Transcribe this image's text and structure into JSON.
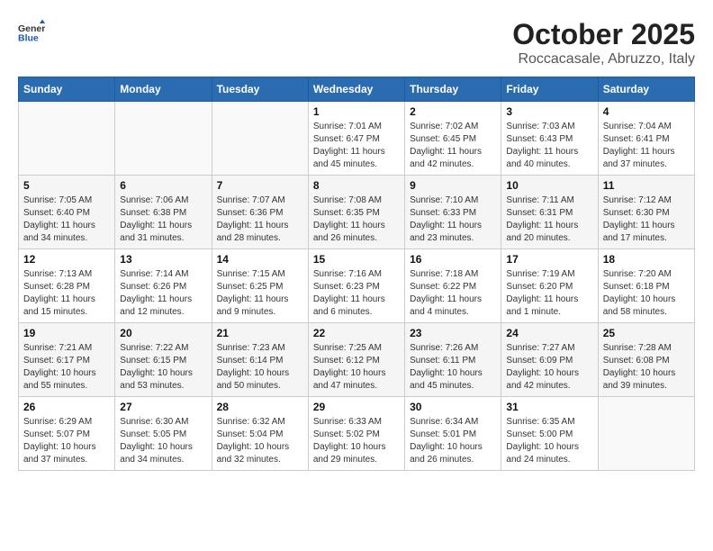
{
  "header": {
    "logo_general": "General",
    "logo_blue": "Blue",
    "month_title": "October 2025",
    "location": "Roccacasale, Abruzzo, Italy"
  },
  "calendar": {
    "weekdays": [
      "Sunday",
      "Monday",
      "Tuesday",
      "Wednesday",
      "Thursday",
      "Friday",
      "Saturday"
    ],
    "weeks": [
      [
        {
          "day": "",
          "sunrise": "",
          "sunset": "",
          "daylight": ""
        },
        {
          "day": "",
          "sunrise": "",
          "sunset": "",
          "daylight": ""
        },
        {
          "day": "",
          "sunrise": "",
          "sunset": "",
          "daylight": ""
        },
        {
          "day": "1",
          "sunrise": "Sunrise: 7:01 AM",
          "sunset": "Sunset: 6:47 PM",
          "daylight": "Daylight: 11 hours and 45 minutes."
        },
        {
          "day": "2",
          "sunrise": "Sunrise: 7:02 AM",
          "sunset": "Sunset: 6:45 PM",
          "daylight": "Daylight: 11 hours and 42 minutes."
        },
        {
          "day": "3",
          "sunrise": "Sunrise: 7:03 AM",
          "sunset": "Sunset: 6:43 PM",
          "daylight": "Daylight: 11 hours and 40 minutes."
        },
        {
          "day": "4",
          "sunrise": "Sunrise: 7:04 AM",
          "sunset": "Sunset: 6:41 PM",
          "daylight": "Daylight: 11 hours and 37 minutes."
        }
      ],
      [
        {
          "day": "5",
          "sunrise": "Sunrise: 7:05 AM",
          "sunset": "Sunset: 6:40 PM",
          "daylight": "Daylight: 11 hours and 34 minutes."
        },
        {
          "day": "6",
          "sunrise": "Sunrise: 7:06 AM",
          "sunset": "Sunset: 6:38 PM",
          "daylight": "Daylight: 11 hours and 31 minutes."
        },
        {
          "day": "7",
          "sunrise": "Sunrise: 7:07 AM",
          "sunset": "Sunset: 6:36 PM",
          "daylight": "Daylight: 11 hours and 28 minutes."
        },
        {
          "day": "8",
          "sunrise": "Sunrise: 7:08 AM",
          "sunset": "Sunset: 6:35 PM",
          "daylight": "Daylight: 11 hours and 26 minutes."
        },
        {
          "day": "9",
          "sunrise": "Sunrise: 7:10 AM",
          "sunset": "Sunset: 6:33 PM",
          "daylight": "Daylight: 11 hours and 23 minutes."
        },
        {
          "day": "10",
          "sunrise": "Sunrise: 7:11 AM",
          "sunset": "Sunset: 6:31 PM",
          "daylight": "Daylight: 11 hours and 20 minutes."
        },
        {
          "day": "11",
          "sunrise": "Sunrise: 7:12 AM",
          "sunset": "Sunset: 6:30 PM",
          "daylight": "Daylight: 11 hours and 17 minutes."
        }
      ],
      [
        {
          "day": "12",
          "sunrise": "Sunrise: 7:13 AM",
          "sunset": "Sunset: 6:28 PM",
          "daylight": "Daylight: 11 hours and 15 minutes."
        },
        {
          "day": "13",
          "sunrise": "Sunrise: 7:14 AM",
          "sunset": "Sunset: 6:26 PM",
          "daylight": "Daylight: 11 hours and 12 minutes."
        },
        {
          "day": "14",
          "sunrise": "Sunrise: 7:15 AM",
          "sunset": "Sunset: 6:25 PM",
          "daylight": "Daylight: 11 hours and 9 minutes."
        },
        {
          "day": "15",
          "sunrise": "Sunrise: 7:16 AM",
          "sunset": "Sunset: 6:23 PM",
          "daylight": "Daylight: 11 hours and 6 minutes."
        },
        {
          "day": "16",
          "sunrise": "Sunrise: 7:18 AM",
          "sunset": "Sunset: 6:22 PM",
          "daylight": "Daylight: 11 hours and 4 minutes."
        },
        {
          "day": "17",
          "sunrise": "Sunrise: 7:19 AM",
          "sunset": "Sunset: 6:20 PM",
          "daylight": "Daylight: 11 hours and 1 minute."
        },
        {
          "day": "18",
          "sunrise": "Sunrise: 7:20 AM",
          "sunset": "Sunset: 6:18 PM",
          "daylight": "Daylight: 10 hours and 58 minutes."
        }
      ],
      [
        {
          "day": "19",
          "sunrise": "Sunrise: 7:21 AM",
          "sunset": "Sunset: 6:17 PM",
          "daylight": "Daylight: 10 hours and 55 minutes."
        },
        {
          "day": "20",
          "sunrise": "Sunrise: 7:22 AM",
          "sunset": "Sunset: 6:15 PM",
          "daylight": "Daylight: 10 hours and 53 minutes."
        },
        {
          "day": "21",
          "sunrise": "Sunrise: 7:23 AM",
          "sunset": "Sunset: 6:14 PM",
          "daylight": "Daylight: 10 hours and 50 minutes."
        },
        {
          "day": "22",
          "sunrise": "Sunrise: 7:25 AM",
          "sunset": "Sunset: 6:12 PM",
          "daylight": "Daylight: 10 hours and 47 minutes."
        },
        {
          "day": "23",
          "sunrise": "Sunrise: 7:26 AM",
          "sunset": "Sunset: 6:11 PM",
          "daylight": "Daylight: 10 hours and 45 minutes."
        },
        {
          "day": "24",
          "sunrise": "Sunrise: 7:27 AM",
          "sunset": "Sunset: 6:09 PM",
          "daylight": "Daylight: 10 hours and 42 minutes."
        },
        {
          "day": "25",
          "sunrise": "Sunrise: 7:28 AM",
          "sunset": "Sunset: 6:08 PM",
          "daylight": "Daylight: 10 hours and 39 minutes."
        }
      ],
      [
        {
          "day": "26",
          "sunrise": "Sunrise: 6:29 AM",
          "sunset": "Sunset: 5:07 PM",
          "daylight": "Daylight: 10 hours and 37 minutes."
        },
        {
          "day": "27",
          "sunrise": "Sunrise: 6:30 AM",
          "sunset": "Sunset: 5:05 PM",
          "daylight": "Daylight: 10 hours and 34 minutes."
        },
        {
          "day": "28",
          "sunrise": "Sunrise: 6:32 AM",
          "sunset": "Sunset: 5:04 PM",
          "daylight": "Daylight: 10 hours and 32 minutes."
        },
        {
          "day": "29",
          "sunrise": "Sunrise: 6:33 AM",
          "sunset": "Sunset: 5:02 PM",
          "daylight": "Daylight: 10 hours and 29 minutes."
        },
        {
          "day": "30",
          "sunrise": "Sunrise: 6:34 AM",
          "sunset": "Sunset: 5:01 PM",
          "daylight": "Daylight: 10 hours and 26 minutes."
        },
        {
          "day": "31",
          "sunrise": "Sunrise: 6:35 AM",
          "sunset": "Sunset: 5:00 PM",
          "daylight": "Daylight: 10 hours and 24 minutes."
        },
        {
          "day": "",
          "sunrise": "",
          "sunset": "",
          "daylight": ""
        }
      ]
    ]
  }
}
